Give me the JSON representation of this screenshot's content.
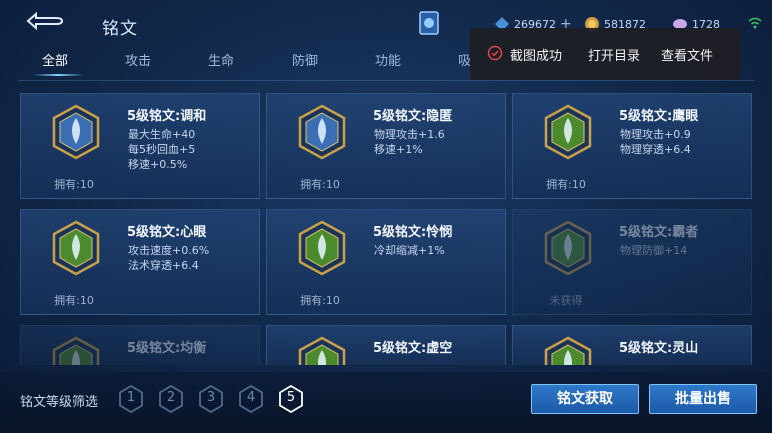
{
  "header": {
    "title": "铭文",
    "currency": [
      {
        "icon": "diamond-icon",
        "value": "269672"
      },
      {
        "icon": "gold-coin-icon",
        "value": "581872"
      },
      {
        "icon": "gem-icon",
        "value": "1728"
      }
    ]
  },
  "tabs": [
    "全部",
    "攻击",
    "生命",
    "防御",
    "功能",
    "吸"
  ],
  "active_tab": "全部",
  "cards": [
    {
      "name": "5级铭文:调和",
      "stats": [
        "最大生命+40",
        "每5秒回血+5",
        "移速+0.5%"
      ],
      "owned": "拥有:10",
      "color": "#3b6fb4"
    },
    {
      "name": "5级铭文:隐匿",
      "stats": [
        "物理攻击+1.6",
        "移速+1%"
      ],
      "owned": "拥有:10",
      "color": "#3b6fb4"
    },
    {
      "name": "5级铭文:鹰眼",
      "stats": [
        "物理攻击+0.9",
        "物理穿透+6.4"
      ],
      "owned": "拥有:10",
      "color": "#4c8a2e"
    },
    {
      "name": "5级铭文:心眼",
      "stats": [
        "攻击速度+0.6%",
        "法术穿透+6.4"
      ],
      "owned": "拥有:10",
      "color": "#4c8a2e"
    },
    {
      "name": "5级铭文:怜悯",
      "stats": [
        "冷却缩减+1%"
      ],
      "owned": "拥有:10",
      "color": "#4c8a2e"
    },
    {
      "name": "5级铭文:霸者",
      "stats": [
        "物理防御+14"
      ],
      "owned": "未获得",
      "color": "#4c8a2e"
    },
    {
      "name": "5级铭文:均衡",
      "stats": [],
      "owned": "",
      "color": "#4c8a2e"
    },
    {
      "name": "5级铭文:虚空",
      "stats": [],
      "owned": "",
      "color": "#4c8a2e"
    },
    {
      "name": "5级铭文:灵山",
      "stats": [],
      "owned": "",
      "color": "#4c8a2e"
    }
  ],
  "filter": {
    "label": "铭文等级筛选",
    "levels": [
      "1",
      "2",
      "3",
      "4",
      "5"
    ],
    "active": "5"
  },
  "buttons": {
    "acquire": "铭文获取",
    "sell": "批量出售"
  },
  "toast": {
    "message": "截图成功",
    "open_dir": "打开目录",
    "view_file": "查看文件"
  }
}
